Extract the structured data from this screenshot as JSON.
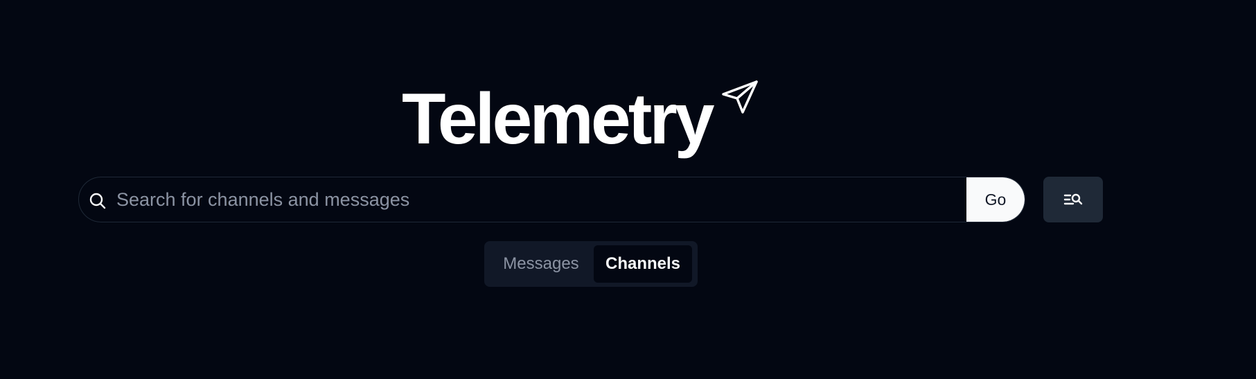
{
  "header": {
    "title": "Telemetry",
    "logo_icon": "paper-plane-icon"
  },
  "search": {
    "placeholder": "Search for channels and messages",
    "value": "",
    "icon": "search-icon",
    "go_label": "Go"
  },
  "advanced_search": {
    "icon": "advanced-search-icon"
  },
  "tabs": [
    {
      "label": "Messages",
      "selected": false
    },
    {
      "label": "Channels",
      "selected": true
    }
  ],
  "colors": {
    "background": "#030712",
    "text": "#f9fafb",
    "muted": "#8b93a3",
    "tab_container": "#111827",
    "advanced_button_bg": "#1f2937"
  }
}
